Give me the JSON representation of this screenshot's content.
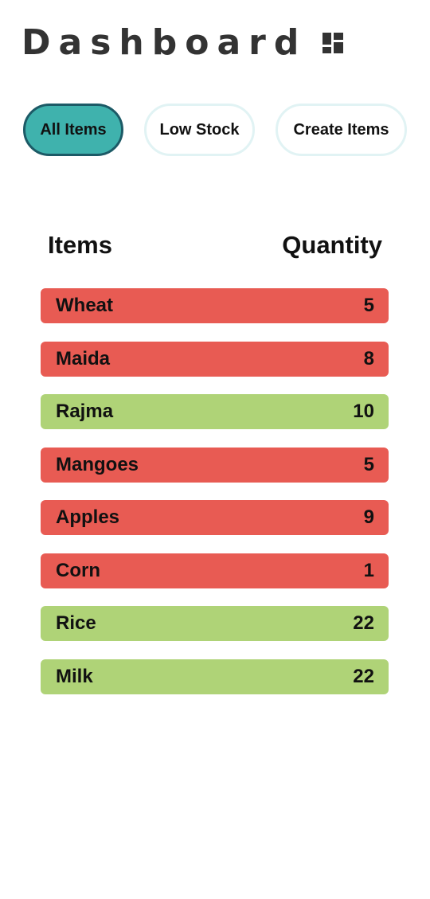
{
  "header": {
    "title": "Dashboard",
    "icon": "dashboard-icon"
  },
  "tabs": [
    {
      "label": "All Items",
      "active": true
    },
    {
      "label": "Low Stock",
      "active": false
    },
    {
      "label": "Create Items",
      "active": false
    }
  ],
  "table": {
    "headers": {
      "item": "Items",
      "quantity": "Quantity"
    },
    "rows": [
      {
        "name": "Wheat",
        "quantity": "5",
        "status": "low"
      },
      {
        "name": "Maida",
        "quantity": "8",
        "status": "low"
      },
      {
        "name": "Rajma",
        "quantity": "10",
        "status": "ok"
      },
      {
        "name": "Mangoes",
        "quantity": "5",
        "status": "low"
      },
      {
        "name": "Apples",
        "quantity": "9",
        "status": "low"
      },
      {
        "name": "Corn",
        "quantity": "1",
        "status": "low"
      },
      {
        "name": "Rice",
        "quantity": "22",
        "status": "ok"
      },
      {
        "name": "Milk",
        "quantity": "22",
        "status": "ok"
      }
    ]
  },
  "colors": {
    "low_stock": "#e85b53",
    "in_stock": "#afd377",
    "active_tab": "#3fb2ad",
    "active_tab_border": "#1c5a66",
    "tab_border": "#e1f3f4"
  }
}
